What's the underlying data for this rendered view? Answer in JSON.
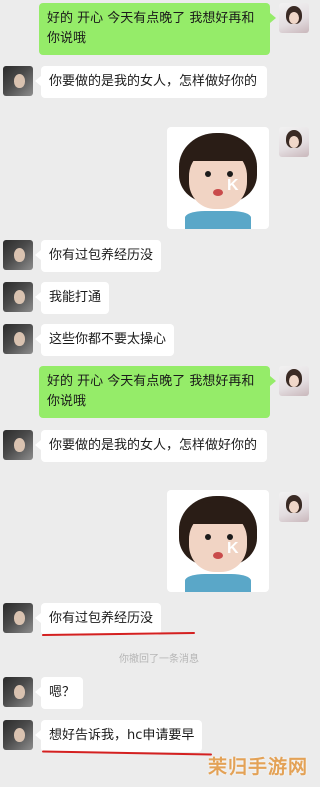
{
  "messages": [
    {
      "side": "right",
      "text": "好的 开心 今天有点晚了 我想好再和你说哦"
    },
    {
      "side": "left",
      "text": "你要做的是我的女人，怎样做好你的"
    },
    {
      "side": "right",
      "sticker_text": "K"
    },
    {
      "side": "left",
      "text": "你有过包养经历没"
    },
    {
      "side": "left",
      "text": "我能打通"
    },
    {
      "side": "left",
      "text": "这些你都不要太操心"
    },
    {
      "side": "right",
      "text": "好的 开心 今天有点晚了 我想好再和你说哦"
    },
    {
      "side": "left",
      "text": "你要做的是我的女人，怎样做好你的"
    },
    {
      "side": "right",
      "sticker_text": "K"
    },
    {
      "side": "left",
      "text": "你有过包养经历没"
    },
    {
      "side": "left",
      "text": "嗯？"
    },
    {
      "side": "left",
      "text": "想好告诉我，hc申请要早"
    }
  ],
  "system_notice": "你撤回了一条消息",
  "watermark": "茉归手游网",
  "colors": {
    "sent_bubble": "#95ec69",
    "received_bubble": "#ffffff",
    "background": "#ececec",
    "underline": "#d42020"
  }
}
